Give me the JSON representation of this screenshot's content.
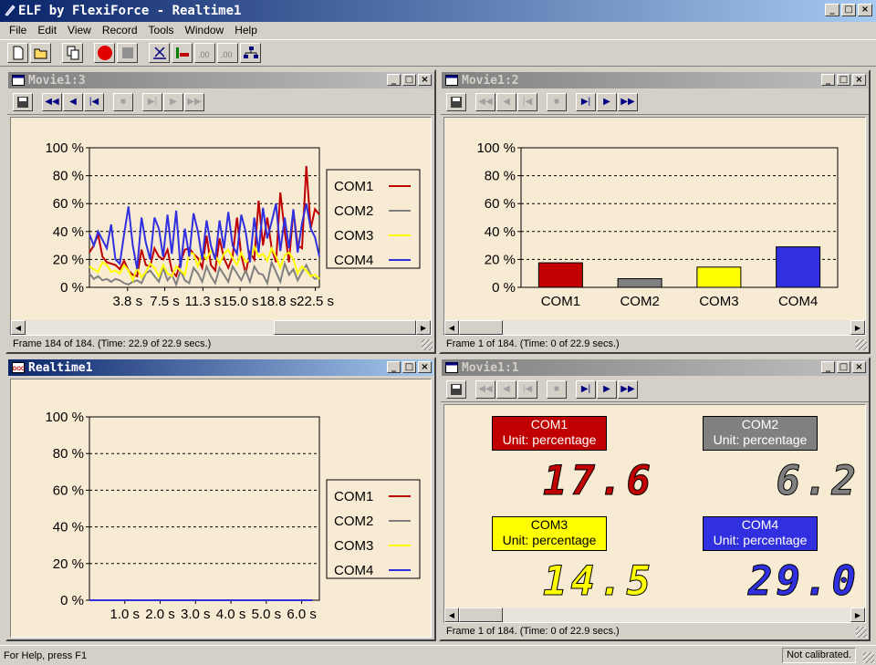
{
  "app": {
    "title": "ELF by FlexiForce - Realtime1"
  },
  "menu": [
    "File",
    "Edit",
    "View",
    "Record",
    "Tools",
    "Window",
    "Help"
  ],
  "colors": {
    "com1": "#c00000",
    "com2": "#808080",
    "com3": "#ffff00",
    "com4": "#3030e0",
    "panel_bg": "#f7ebd3"
  },
  "movie3": {
    "title": "Movie1:3",
    "status": "Frame 184 of 184. (Time: 22.9 of 22.9 secs.)",
    "legend": [
      "COM1",
      "COM2",
      "COM3",
      "COM4"
    ],
    "chart_data": {
      "type": "line",
      "y_ticks": [
        "100 %",
        "80 %",
        "60 %",
        "40 %",
        "20 %",
        "0 %"
      ],
      "x_ticks": [
        "3.8 s",
        "7.5 s",
        "11.3 s",
        "15.0 s",
        "18.8 s",
        "22.5 s"
      ],
      "ylim": [
        0,
        100
      ],
      "xlim": [
        0,
        22.9
      ],
      "series": [
        {
          "name": "COM1",
          "values": [
            25,
            30,
            38,
            22,
            18,
            17,
            16,
            13,
            19,
            12,
            9,
            8,
            27,
            16,
            15,
            28,
            22,
            20,
            27,
            12,
            8,
            18,
            27,
            28,
            24,
            21,
            14,
            37,
            16,
            12,
            35,
            21,
            14,
            22,
            50,
            23,
            10,
            25,
            20,
            62,
            30,
            50,
            28,
            18,
            68,
            40,
            18,
            55,
            30,
            28,
            87,
            42,
            56,
            52
          ]
        },
        {
          "name": "COM2",
          "values": [
            10,
            6,
            8,
            5,
            6,
            4,
            6,
            5,
            3,
            2,
            4,
            5,
            3,
            10,
            12,
            8,
            4,
            14,
            5,
            9,
            2,
            12,
            5,
            3,
            14,
            10,
            4,
            15,
            8,
            3,
            14,
            9,
            4,
            15,
            10,
            5,
            12,
            4,
            15,
            10,
            9,
            3,
            18,
            11,
            4,
            17,
            9,
            13,
            5,
            11,
            16,
            9,
            6,
            7
          ]
        },
        {
          "name": "COM3",
          "values": [
            15,
            13,
            11,
            18,
            16,
            11,
            12,
            10,
            16,
            12,
            5,
            14,
            7,
            11,
            17,
            14,
            8,
            16,
            10,
            8,
            15,
            12,
            9,
            25,
            24,
            15,
            25,
            20,
            26,
            23,
            17,
            24,
            27,
            21,
            16,
            25,
            18,
            20,
            29,
            22,
            24,
            19,
            28,
            22,
            14,
            23,
            25,
            20,
            10,
            15,
            12,
            8,
            9,
            6
          ]
        },
        {
          "name": "COM4",
          "values": [
            38,
            30,
            40,
            34,
            28,
            45,
            20,
            17,
            38,
            58,
            30,
            13,
            50,
            32,
            20,
            50,
            42,
            22,
            52,
            24,
            55,
            14,
            42,
            22,
            53,
            40,
            20,
            48,
            30,
            20,
            48,
            28,
            54,
            30,
            24,
            52,
            40,
            18,
            50,
            25,
            57,
            35,
            47,
            60,
            26,
            50,
            28,
            56,
            25,
            46,
            60,
            42,
            36,
            22
          ]
        }
      ]
    },
    "scroll_h": {
      "position": 1.0
    }
  },
  "movie2": {
    "title": "Movie1:2",
    "status": "Frame 1 of 184. (Time: 0 of 22.9 secs.)",
    "chart_data": {
      "type": "bar",
      "y_ticks": [
        "100 %",
        "80 %",
        "60 %",
        "40 %",
        "20 %",
        "0 %"
      ],
      "categories": [
        "COM1",
        "COM2",
        "COM3",
        "COM4"
      ],
      "values": [
        17.6,
        6.2,
        14.5,
        29.0
      ],
      "ylim": [
        0,
        100
      ]
    },
    "scroll_h": {
      "position": 0.0
    }
  },
  "realtime": {
    "title": "Realtime1",
    "legend": [
      "COM1",
      "COM2",
      "COM3",
      "COM4"
    ],
    "chart_data": {
      "type": "line",
      "y_ticks": [
        "100 %",
        "80 %",
        "60 %",
        "40 %",
        "20 %",
        "0 %"
      ],
      "x_ticks": [
        "1.0 s",
        "2.0 s",
        "3.0 s",
        "4.0 s",
        "5.0 s",
        "6.0 s"
      ],
      "ylim": [
        0,
        100
      ],
      "xlim": [
        0,
        6.5
      ],
      "series": [
        {
          "name": "COM1",
          "values": [
            0,
            0
          ]
        },
        {
          "name": "COM2",
          "values": [
            0,
            0
          ]
        },
        {
          "name": "COM3",
          "values": [
            0,
            0
          ]
        },
        {
          "name": "COM4",
          "values": [
            0,
            0
          ]
        }
      ]
    }
  },
  "movie1": {
    "title": "Movie1:1",
    "status": "Frame 1 of 184. (Time: 0 of 22.9 secs.)",
    "sensors": [
      {
        "name": "COM1",
        "unit": "Unit: percentage",
        "value": "17.6"
      },
      {
        "name": "COM2",
        "unit": "Unit: percentage",
        "value": "6.2"
      },
      {
        "name": "COM3",
        "unit": "Unit: percentage",
        "value": "14.5"
      },
      {
        "name": "COM4",
        "unit": "Unit: percentage",
        "value": "29.0"
      }
    ],
    "scroll_h": {
      "position": 0.0
    }
  },
  "statusbar": {
    "help": "For Help, press F1",
    "calibration": "Not calibrated."
  }
}
